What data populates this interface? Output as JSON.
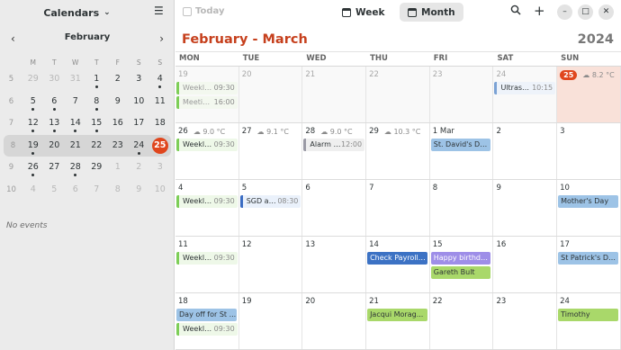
{
  "sidebar": {
    "calendars_label": "Calendars",
    "mini": {
      "month": "February",
      "weekdays": [
        "M",
        "T",
        "W",
        "T",
        "F",
        "S",
        "S"
      ],
      "weeks": [
        {
          "wk": "5",
          "days": [
            {
              "d": "29",
              "dim": true
            },
            {
              "d": "30",
              "dim": true
            },
            {
              "d": "31",
              "dim": true
            },
            {
              "d": "1",
              "dot": true
            },
            {
              "d": "2"
            },
            {
              "d": "3"
            },
            {
              "d": "4",
              "dot": true
            }
          ]
        },
        {
          "wk": "6",
          "days": [
            {
              "d": "5",
              "dot": true
            },
            {
              "d": "6",
              "dot": true
            },
            {
              "d": "7"
            },
            {
              "d": "8",
              "dot": true
            },
            {
              "d": "9"
            },
            {
              "d": "10"
            },
            {
              "d": "11"
            }
          ]
        },
        {
          "wk": "7",
          "days": [
            {
              "d": "12",
              "dot": true
            },
            {
              "d": "13",
              "dot": true
            },
            {
              "d": "14",
              "dot": true
            },
            {
              "d": "15",
              "dot": true
            },
            {
              "d": "16"
            },
            {
              "d": "17"
            },
            {
              "d": "18"
            }
          ]
        },
        {
          "wk": "8",
          "sel": true,
          "days": [
            {
              "d": "19",
              "dot": true
            },
            {
              "d": "20"
            },
            {
              "d": "21"
            },
            {
              "d": "22"
            },
            {
              "d": "23"
            },
            {
              "d": "24",
              "dot": true
            },
            {
              "d": "25",
              "today": true
            }
          ]
        },
        {
          "wk": "9",
          "days": [
            {
              "d": "26",
              "dot": true
            },
            {
              "d": "27"
            },
            {
              "d": "28",
              "dot": true
            },
            {
              "d": "29"
            },
            {
              "d": "1",
              "dim": true
            },
            {
              "d": "2",
              "dim": true
            },
            {
              "d": "3",
              "dim": true
            }
          ]
        },
        {
          "wk": "10",
          "days": [
            {
              "d": "4",
              "dim": true
            },
            {
              "d": "5",
              "dim": true
            },
            {
              "d": "6",
              "dim": true
            },
            {
              "d": "7",
              "dim": true
            },
            {
              "d": "8",
              "dim": true
            },
            {
              "d": "9",
              "dim": true
            },
            {
              "d": "10",
              "dim": true
            }
          ]
        }
      ]
    },
    "no_events": "No events"
  },
  "toolbar": {
    "today_label": "Today",
    "week_label": "Week",
    "month_label": "Month"
  },
  "header": {
    "title": "February - March",
    "year": "2024"
  },
  "weekdays": [
    "MON",
    "TUE",
    "WED",
    "THU",
    "FRI",
    "SAT",
    "SUN"
  ],
  "weeks": [
    [
      {
        "num": "19",
        "out": true,
        "events": [
          {
            "kind": "ev",
            "style": "green faded",
            "title": "Weekly ...",
            "time": "09:30"
          },
          {
            "kind": "ev",
            "style": "green faded",
            "title": "Meetin...",
            "time": "16:00"
          }
        ]
      },
      {
        "num": "20",
        "out": true,
        "events": []
      },
      {
        "num": "21",
        "out": true,
        "events": []
      },
      {
        "num": "22",
        "out": true,
        "events": []
      },
      {
        "num": "23",
        "out": true,
        "events": []
      },
      {
        "num": "24",
        "out": true,
        "events": [
          {
            "kind": "ev",
            "style": "blue",
            "title": "Ultraso...",
            "time": "10:15"
          }
        ]
      },
      {
        "num": "25",
        "today": true,
        "weather": "8.2 °C",
        "events": []
      }
    ],
    [
      {
        "num": "26",
        "weather": "9.0 °C",
        "events": [
          {
            "kind": "ev",
            "style": "green",
            "title": "Weekly ...",
            "time": "09:30"
          }
        ]
      },
      {
        "num": "27",
        "weather": "9.1 °C",
        "events": []
      },
      {
        "num": "28",
        "weather": "9.0 °C",
        "events": [
          {
            "kind": "ev",
            "style": "gray",
            "title": "Alarm S...",
            "time": "12:00"
          }
        ]
      },
      {
        "num": "29",
        "weather": "10.3 °C",
        "events": []
      },
      {
        "num": "1 Mar",
        "events": [
          {
            "kind": "pill",
            "style": "lblue",
            "title": "St. David's Day..."
          }
        ]
      },
      {
        "num": "2",
        "events": []
      },
      {
        "num": "3",
        "events": []
      }
    ],
    [
      {
        "num": "4",
        "events": [
          {
            "kind": "ev",
            "style": "green",
            "title": "Weekly ...",
            "time": "09:30"
          }
        ]
      },
      {
        "num": "5",
        "events": [
          {
            "kind": "ev",
            "style": "navy",
            "title": "SGD ala...",
            "time": "08:30"
          }
        ]
      },
      {
        "num": "6",
        "events": []
      },
      {
        "num": "7",
        "events": []
      },
      {
        "num": "8",
        "events": []
      },
      {
        "num": "9",
        "events": []
      },
      {
        "num": "10",
        "events": [
          {
            "kind": "pill",
            "style": "lblue",
            "title": "Mother's Day"
          }
        ]
      }
    ],
    [
      {
        "num": "11",
        "events": [
          {
            "kind": "ev",
            "style": "green",
            "title": "Weekly ...",
            "time": "09:30"
          }
        ]
      },
      {
        "num": "12",
        "events": []
      },
      {
        "num": "13",
        "events": []
      },
      {
        "num": "14",
        "events": [
          {
            "kind": "pill",
            "style": "dblue",
            "title": "Check Payroll ..."
          }
        ]
      },
      {
        "num": "15",
        "events": [
          {
            "kind": "pill",
            "style": "purple",
            "title": "Happy birthday!"
          },
          {
            "kind": "pill",
            "style": "lgreen",
            "title": "Gareth Bult"
          }
        ]
      },
      {
        "num": "16",
        "events": []
      },
      {
        "num": "17",
        "events": [
          {
            "kind": "pill",
            "style": "lblue",
            "title": "St Patrick's Da..."
          }
        ]
      }
    ],
    [
      {
        "num": "18",
        "events": [
          {
            "kind": "pill",
            "style": "lblue",
            "title": "Day off for St ..."
          },
          {
            "kind": "ev",
            "style": "green",
            "title": "Weekly ...",
            "time": "09:30"
          }
        ]
      },
      {
        "num": "19",
        "events": []
      },
      {
        "num": "20",
        "events": []
      },
      {
        "num": "21",
        "events": [
          {
            "kind": "pill",
            "style": "lgreen",
            "title": "Jacqui Morag..."
          }
        ]
      },
      {
        "num": "22",
        "events": []
      },
      {
        "num": "23",
        "events": []
      },
      {
        "num": "24",
        "events": [
          {
            "kind": "pill",
            "style": "lgreen",
            "title": "Timothy"
          }
        ]
      }
    ]
  ]
}
